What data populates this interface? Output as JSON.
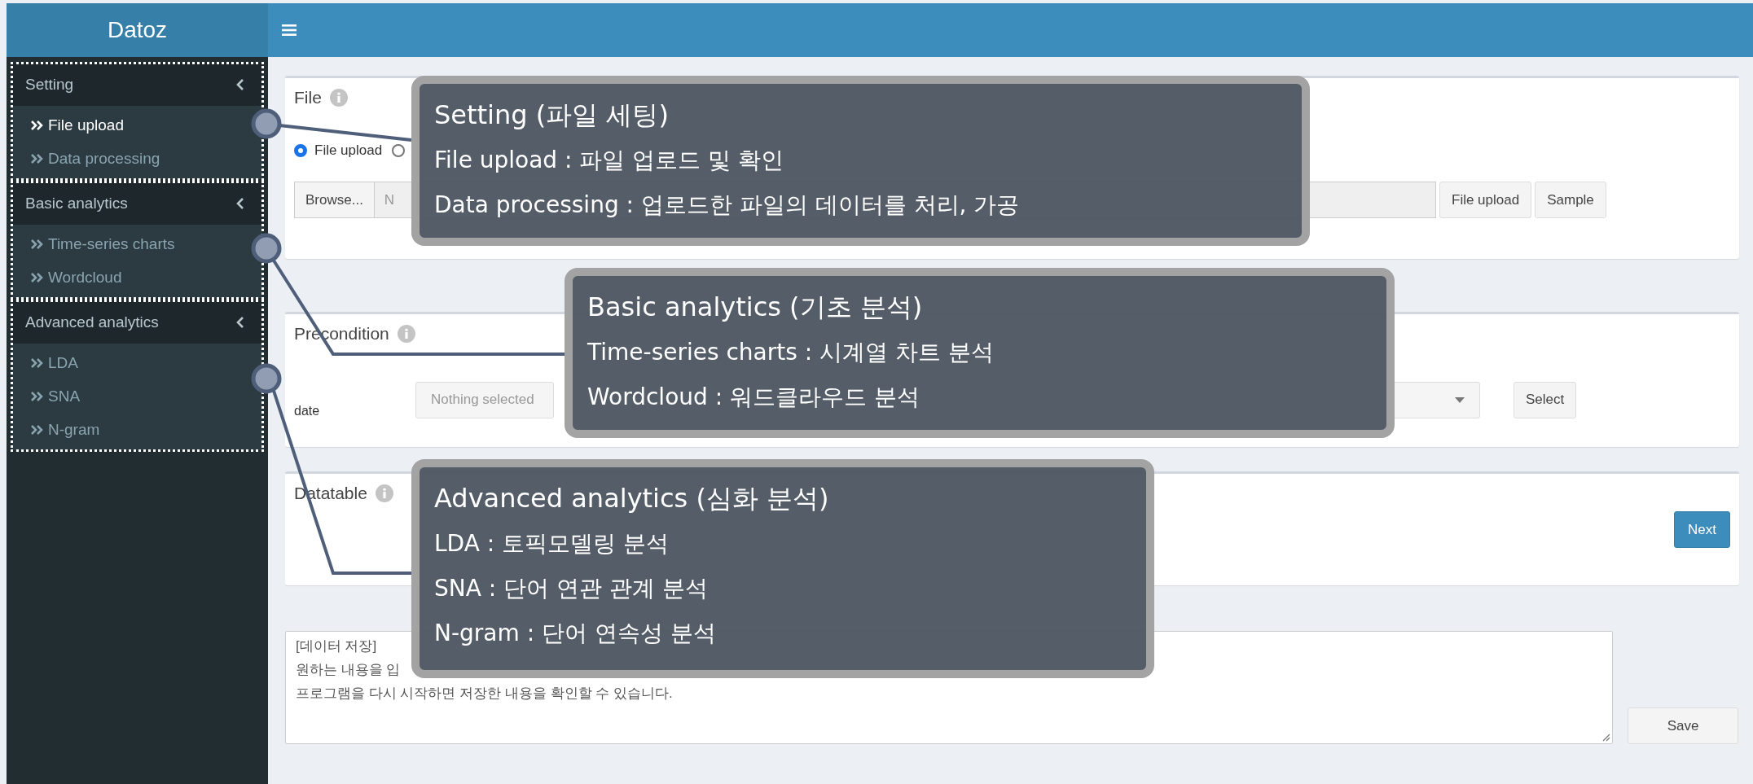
{
  "header": {
    "title": "Datoz"
  },
  "sidebar": {
    "sections": [
      {
        "label": "Setting",
        "items": [
          {
            "label": "File upload",
            "selected": true
          },
          {
            "label": "Data processing",
            "selected": false
          }
        ]
      },
      {
        "label": "Basic analytics",
        "items": [
          {
            "label": "Time-series charts",
            "selected": false
          },
          {
            "label": "Wordcloud",
            "selected": false
          }
        ]
      },
      {
        "label": "Advanced analytics",
        "items": [
          {
            "label": "LDA",
            "selected": false
          },
          {
            "label": "SNA",
            "selected": false
          },
          {
            "label": "N-gram",
            "selected": false
          }
        ]
      }
    ]
  },
  "file_panel": {
    "title": "File",
    "sources": [
      {
        "label": "File upload",
        "selected": true
      },
      {
        "selected": false
      }
    ],
    "browse_button": "Browse...",
    "file_placeholder": "N",
    "buttons": [
      "File upload",
      "Sample"
    ]
  },
  "precondition_panel": {
    "title": "Precondition",
    "fields": [
      {
        "kind": "dropdown",
        "label": "date",
        "placeholder": "Nothing selected"
      },
      {
        "kind": "dropdown"
      }
    ],
    "button": "Select"
  },
  "datatable_panel": {
    "title": "Datatable",
    "button": "Next"
  },
  "notes": {
    "value": "[데이터 저장]\n원하는 내용을 입\n프로그램을 다시 시작하면 저장한 내용을 확인할 수 있습니다.",
    "button": "Save"
  },
  "callouts": [
    {
      "title": "Setting (파일 세팅)",
      "lines": [
        "File upload : 파일 업로드 및 확인",
        "Data processing : 업로드한 파일의 데이터를 처리, 가공"
      ]
    },
    {
      "title": "Basic analytics (기초 분석)",
      "lines": [
        "Time-series charts : 시계열 차트 분석",
        "Wordcloud : 워드클라우드 분석"
      ]
    },
    {
      "title": "Advanced analytics (심화 분석)",
      "lines": [
        "LDA : 토픽모델링 분석",
        "SNA : 단어 연관 관계 분석",
        "N-gram : 단어 연속성 분석"
      ]
    }
  ]
}
